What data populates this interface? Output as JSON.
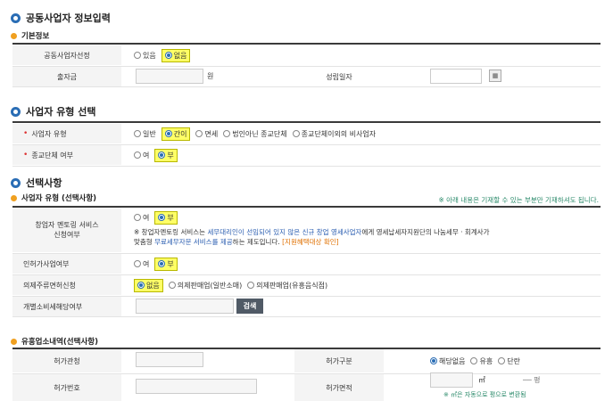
{
  "sections": {
    "joint": {
      "title": "공동사업자 정보입력",
      "basic_title": "기본정보",
      "joint_label": "공동사업자선정",
      "joint_options": [
        "있음",
        "없음"
      ],
      "capital_label": "출자금",
      "capital_unit": "원",
      "date_label": "성립일자"
    },
    "biztype": {
      "title": "사업자 유형 선택",
      "type_label": "사업자 유형",
      "type_options": [
        "일반",
        "간이",
        "면세",
        "법인아닌 종교단체",
        "종교단체이외의 비사업자"
      ],
      "religion_label": "종교단체 여부",
      "religion_options": [
        "여",
        "부"
      ]
    },
    "optional": {
      "title": "선택사항",
      "sub_title": "사업자 유형 (선택사항)",
      "hint": "※ 아래 내용은 기재할 수 있는 부분만 기재하셔도 됩니다.",
      "mentor_label_1": "창업자 멘토링 서비스",
      "mentor_label_2": "신청여부",
      "mentor_options": [
        "여",
        "부"
      ],
      "mentor_note": {
        "p1": "※ 창업자멘토링 서비스는 ",
        "b1": "세무대리인이 선임되어 있지 않은 신규 창업 영세사업자",
        "p2": "에게 영세납세자지원단의 나눔세무 · 회계사가",
        "p3": "맞춤형 ",
        "b2": "무료세무자문 서비스를 제공",
        "p4": "하는 제도입니다. ",
        "o1": "[지원혜택대상 확인]"
      },
      "permit_label": "인허가사업여부",
      "permit_options": [
        "여",
        "부"
      ],
      "liquor_label": "의제주류면허신청",
      "liquor_options": [
        "없음",
        "의제판매업(일반소매)",
        "의제판매업(유흥음식점)"
      ],
      "excise_label": "개별소비세해당여부",
      "search_button": "검색"
    },
    "entertainment": {
      "sub_title": "유흥업소내역(선택사항)",
      "permit_office_label": "허가관청",
      "permit_type_label": "허가구분",
      "permit_type_options": [
        "해당없음",
        "유흥",
        "단란"
      ],
      "permit_no_label": "허가번호",
      "area_label": "허가면적",
      "area_unit": "㎡",
      "pyeong_unit": "── 평",
      "area_note": "※ ㎡은 자동으로 평으로 변환됨"
    }
  },
  "colors": {
    "accent": "#2a6db5",
    "highlight": "#ffff66",
    "sub_dot": "#f0a020",
    "required": "#dd3333"
  }
}
